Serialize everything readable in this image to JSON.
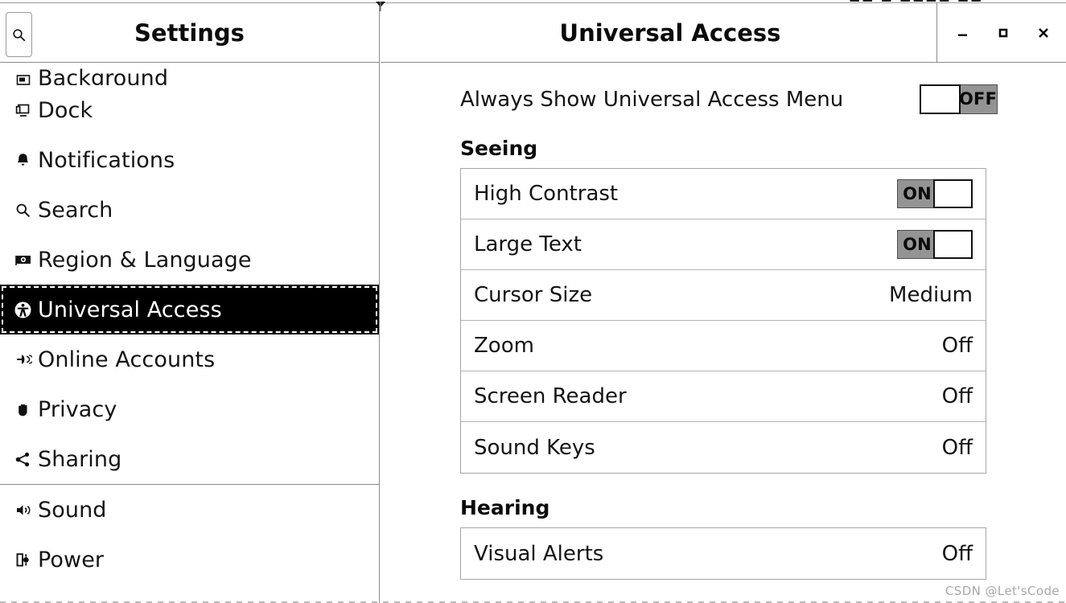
{
  "window": {
    "sidebar_title": "Settings",
    "content_title": "Universal Access",
    "controls": {
      "minimize_label": "–",
      "maximize_label": "□",
      "close_label": "✕"
    }
  },
  "search": {
    "icon": "search-icon"
  },
  "sidebar": {
    "items": [
      {
        "label": "Background",
        "icon": "background-icon",
        "selected": false,
        "clipped": true
      },
      {
        "label": "Dock",
        "icon": "dock-icon",
        "selected": false
      },
      {
        "label": "Notifications",
        "icon": "bell-icon",
        "selected": false
      },
      {
        "label": "Search",
        "icon": "search-icon",
        "selected": false
      },
      {
        "label": "Region & Language",
        "icon": "language-icon",
        "selected": false
      },
      {
        "label": "Universal Access",
        "icon": "accessibility-icon",
        "selected": true
      },
      {
        "label": "Online Accounts",
        "icon": "online-accounts-icon",
        "selected": false
      },
      {
        "label": "Privacy",
        "icon": "hand-icon",
        "selected": false
      },
      {
        "label": "Sharing",
        "icon": "share-icon",
        "selected": false,
        "separator_after": true
      },
      {
        "label": "Sound",
        "icon": "speaker-icon",
        "selected": false
      },
      {
        "label": "Power",
        "icon": "power-plug-icon",
        "selected": false
      }
    ]
  },
  "main": {
    "always_show_menu": {
      "label": "Always Show Universal Access Menu",
      "state": "OFF"
    },
    "sections": [
      {
        "title": "Seeing",
        "rows": [
          {
            "label": "High Contrast",
            "type": "switch",
            "state": "ON"
          },
          {
            "label": "Large Text",
            "type": "switch",
            "state": "ON"
          },
          {
            "label": "Cursor Size",
            "type": "value",
            "value": "Medium"
          },
          {
            "label": "Zoom",
            "type": "value",
            "value": "Off"
          },
          {
            "label": "Screen Reader",
            "type": "value",
            "value": "Off"
          },
          {
            "label": "Sound Keys",
            "type": "value",
            "value": "Off"
          }
        ]
      },
      {
        "title": "Hearing",
        "rows": [
          {
            "label": "Visual Alerts",
            "type": "value",
            "value": "Off"
          }
        ]
      }
    ]
  },
  "watermark": {
    "text": "CSDN @Let'sCode"
  },
  "menubar_remnant": {
    "glyphs": "■■ ■ ■■■■  ■■"
  },
  "colors": {
    "selected_bg": "#000000",
    "switch_track": "#949494",
    "border": "#8c8c8c"
  }
}
